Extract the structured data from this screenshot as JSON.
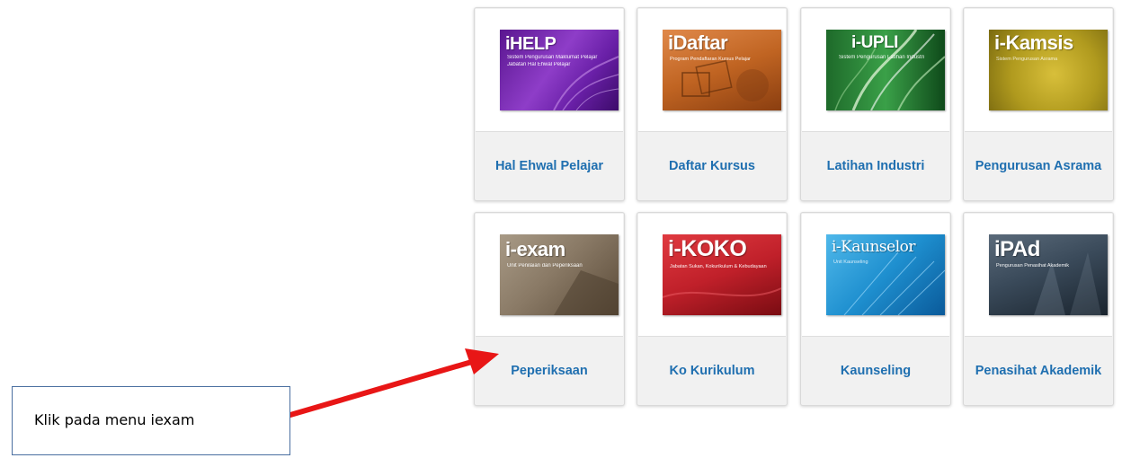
{
  "tiles": [
    {
      "label": "Hal Ehwal Pelajar",
      "brand": "iHELP",
      "tagline": [
        "Sistem Pengurusan Maklumat Pelajar",
        "Jabatan Hal Ehwal Pelajar"
      ],
      "bg_color": "#7a2fb0",
      "logo_icon": "ihelp-logo"
    },
    {
      "label": "Daftar Kursus",
      "brand": "iDaftar",
      "tagline": [
        "Program Pendaftaran Kursus Pelajar"
      ],
      "bg_color": "#c8702b",
      "logo_icon": "idaftar-logo"
    },
    {
      "label": "Latihan Industri",
      "brand": "i-UPLI",
      "tagline": [
        "Sistem Pengurusan Latihan Industri"
      ],
      "bg_color": "#2e8b3c",
      "logo_icon": "iupli-logo"
    },
    {
      "label": "Pengurusan Asrama",
      "brand": "i-Kamsis",
      "tagline": [
        "Sistem Pengurusan Asrama"
      ],
      "bg_color": "#b09a1e",
      "logo_icon": "ikamsis-logo"
    },
    {
      "label": "Peperiksaan",
      "brand": "i-exam",
      "tagline": [
        "Unit Penilaian dan Peperiksaan"
      ],
      "bg_color": "#8a7a66",
      "logo_icon": "iexam-logo"
    },
    {
      "label": "Ko Kurikulum",
      "brand": "i-KOKO",
      "tagline": [
        "Jabatan Sukan, Kokurikulum & Kebudayaan"
      ],
      "bg_color": "#c0202a",
      "logo_icon": "ikoko-logo"
    },
    {
      "label": "Kaunseling",
      "brand": "i-Kaunselor",
      "tagline": [
        "Unit Kaunseling"
      ],
      "bg_color": "#1e8fcf",
      "logo_icon": "ikaunselor-logo"
    },
    {
      "label": "Penasihat Akademik",
      "brand": "iPAd",
      "tagline": [
        "Pengurusan Penasihat Akademik"
      ],
      "bg_color": "#3a4a5a",
      "logo_icon": "ipad-logo"
    }
  ],
  "callout": {
    "text": "Klik pada menu iexam",
    "arrow_color": "#e81616"
  }
}
